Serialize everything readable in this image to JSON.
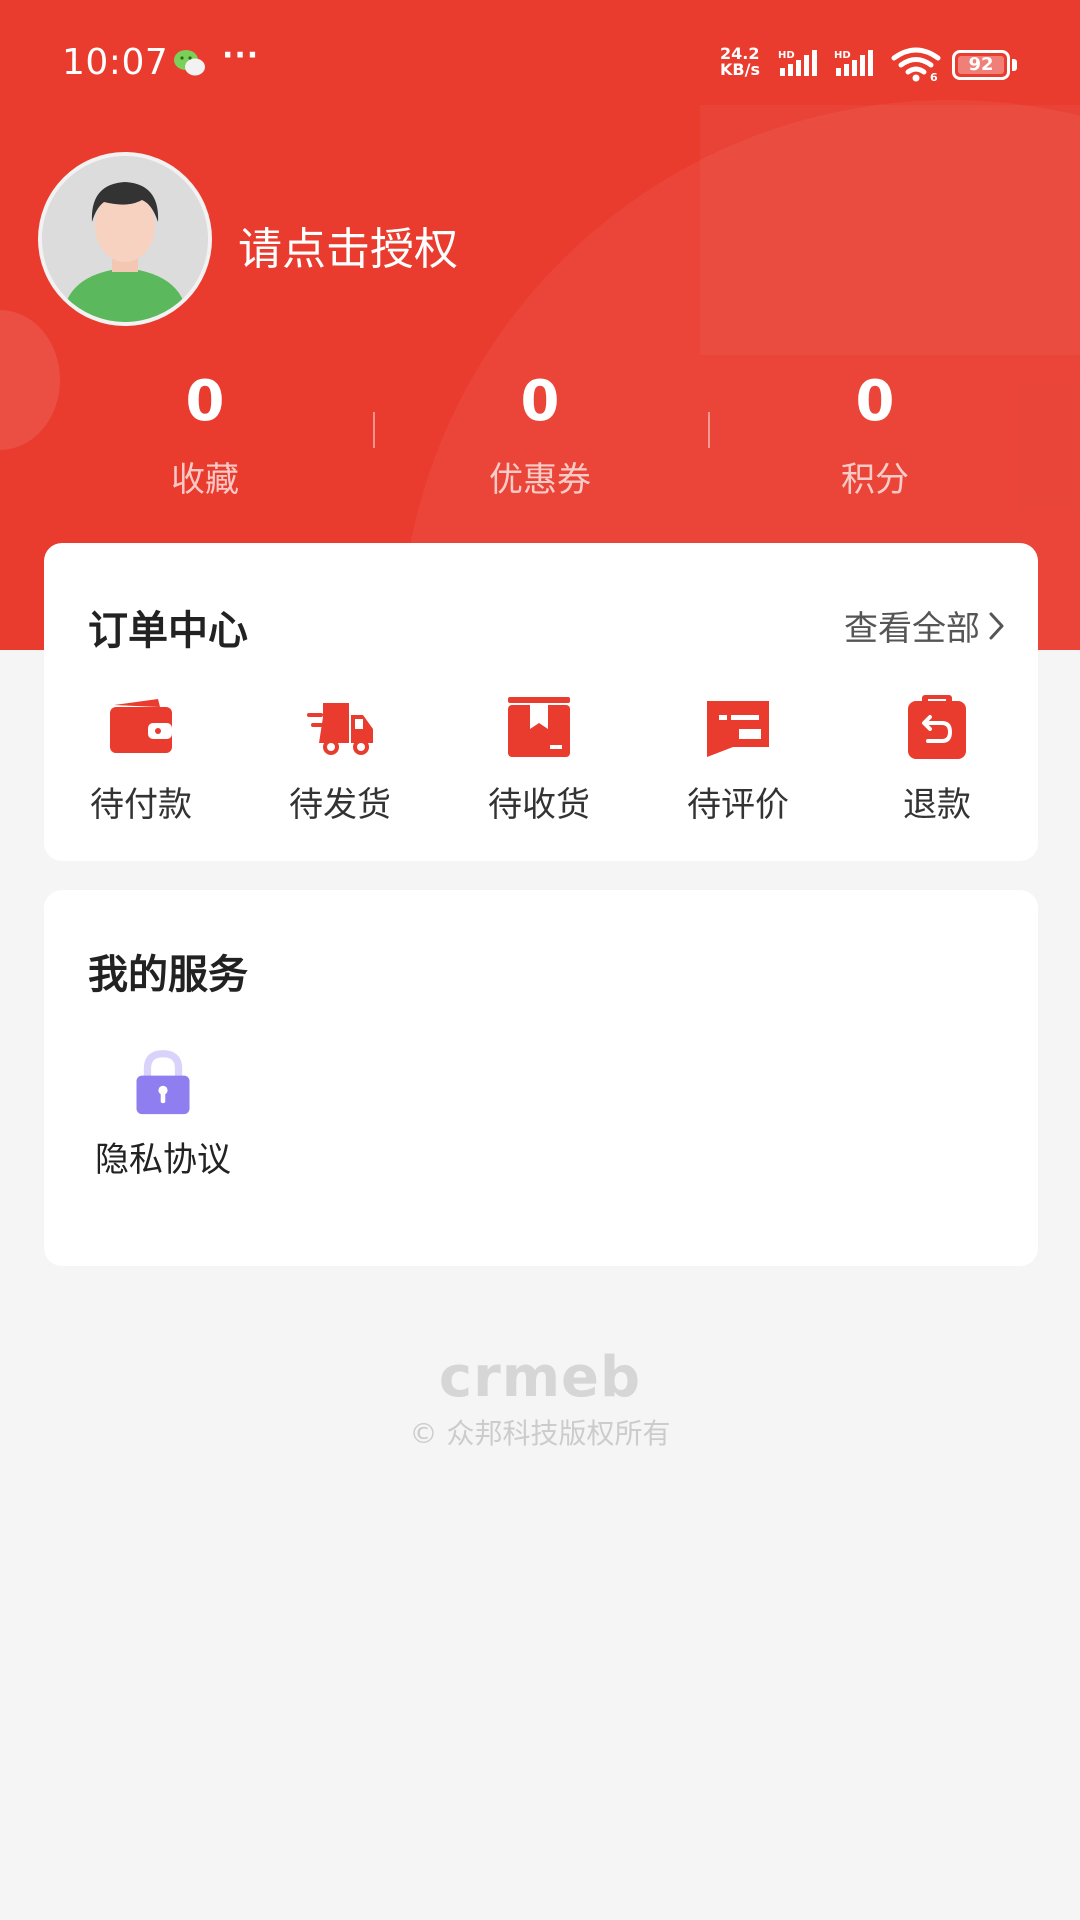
{
  "status_bar": {
    "time": "10:07",
    "net_speed_value": "24.2",
    "net_speed_unit": "KB/s",
    "signal_label_1": "HD",
    "signal_label_2": "HD",
    "wifi_label": "6",
    "battery": "92"
  },
  "profile": {
    "auth_prompt": "请点击授权"
  },
  "stats": [
    {
      "value": "0",
      "label": "收藏"
    },
    {
      "value": "0",
      "label": "优惠券"
    },
    {
      "value": "0",
      "label": "积分"
    }
  ],
  "order_center": {
    "title": "订单中心",
    "view_all": "查看全部",
    "items": [
      {
        "label": "待付款",
        "icon": "wallet-icon"
      },
      {
        "label": "待发货",
        "icon": "truck-icon"
      },
      {
        "label": "待收货",
        "icon": "package-icon"
      },
      {
        "label": "待评价",
        "icon": "comment-icon"
      },
      {
        "label": "退款",
        "icon": "refund-icon"
      }
    ]
  },
  "my_services": {
    "title": "我的服务",
    "items": [
      {
        "label": "隐私协议",
        "icon": "lock-icon"
      }
    ]
  },
  "footer": {
    "logo": "crmeb",
    "copyright": "© 众邦科技版权所有"
  },
  "colors": {
    "brand_red": "#e93b2e",
    "privacy_purple": "#8f7ef0"
  }
}
